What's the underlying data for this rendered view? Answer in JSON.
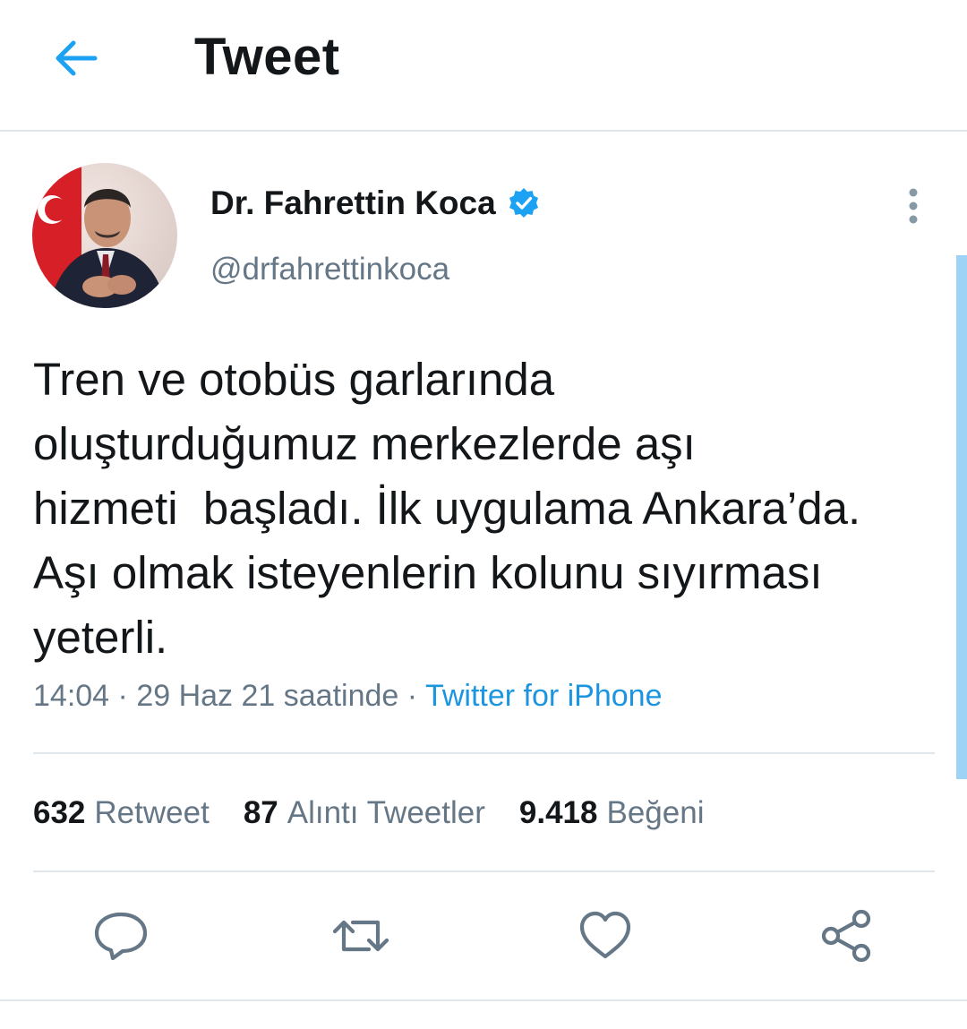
{
  "header": {
    "title": "Tweet"
  },
  "author": {
    "name": "Dr. Fahrettin Koca",
    "handle": "@drfahrettinkoca",
    "verified": true
  },
  "tweet": {
    "text": "Tren ve otobüs garlarında\noluşturduğumuz merkezlerde aşı\nhizmeti  başladı. İlk uygulama Ankara’da.\nAşı olmak isteyenlerin kolunu sıyırması\nyeterli.",
    "time": "14:04",
    "date": "29 Haz 21 saatinde",
    "separator": "·",
    "source": "Twitter for iPhone"
  },
  "stats": {
    "retweets": {
      "count": "632",
      "label": "Retweet"
    },
    "quotes": {
      "count": "87",
      "label": "Alıntı Tweetler"
    },
    "likes": {
      "count": "9.418",
      "label": "Beğeni"
    }
  },
  "icons": {
    "back": "arrow-left-icon",
    "verified": "verified-badge-icon",
    "more": "more-vertical-icon",
    "reply": "comment-icon",
    "retweet": "retweet-icon",
    "like": "heart-icon",
    "share": "share-icon"
  },
  "colors": {
    "accent": "#1da1f2",
    "link": "#1b95e0",
    "secondary_text": "#657786",
    "primary_text": "#14171a",
    "divider": "#e1e6ea"
  }
}
